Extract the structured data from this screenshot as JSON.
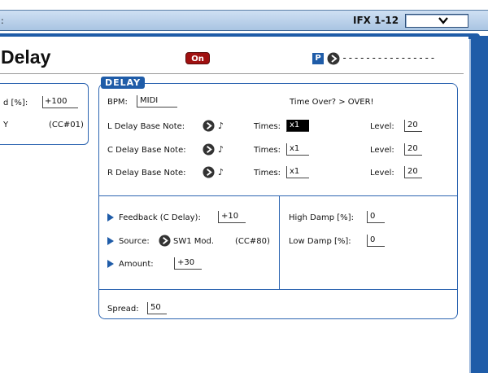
{
  "topbar": {
    "colon": ":",
    "program": "IFX 1-12"
  },
  "header": {
    "title": "Delay",
    "on_label": "On",
    "p_label": "P",
    "dashes": "----------------"
  },
  "left_panel": {
    "line1_label": "d [%]:",
    "line1_value": "+100",
    "line2_label": "Y",
    "line2_cc": "(CC#01)"
  },
  "delay": {
    "section_title": "DELAY",
    "bpm_label": "BPM:",
    "bpm_value": "MIDI",
    "time_over": "Time Over? > OVER!",
    "rows": [
      {
        "label": "L Delay Base Note:",
        "note": "♪",
        "times_label": "Times:",
        "times": "x1",
        "level_label": "Level:",
        "level": "20"
      },
      {
        "label": "C Delay Base Note:",
        "note": "♪",
        "times_label": "Times:",
        "times": "x1",
        "level_label": "Level:",
        "level": "20"
      },
      {
        "label": "R Delay Base Note:",
        "note": "♪",
        "times_label": "Times:",
        "times": "x1",
        "level_label": "Level:",
        "level": "20"
      }
    ],
    "feedback_label": "Feedback (C Delay):",
    "feedback_value": "+10",
    "source_label": "Source:",
    "source_value": "SW1 Mod.",
    "source_cc": "(CC#80)",
    "amount_label": "Amount:",
    "amount_value": "+30",
    "high_damp_label": "High Damp [%]:",
    "high_damp_value": "0",
    "low_damp_label": "Low Damp [%]:",
    "low_damp_value": "0",
    "spread_label": "Spread:",
    "spread_value": "50"
  },
  "colors": {
    "accent": "#1f5ca8",
    "on_button": "#a01010",
    "frame": "#2d65b1"
  },
  "icons": {
    "dropdown": "chevron-down-icon",
    "select": "right-arrow-circle-icon",
    "modulation": "play-triangle-icon"
  }
}
